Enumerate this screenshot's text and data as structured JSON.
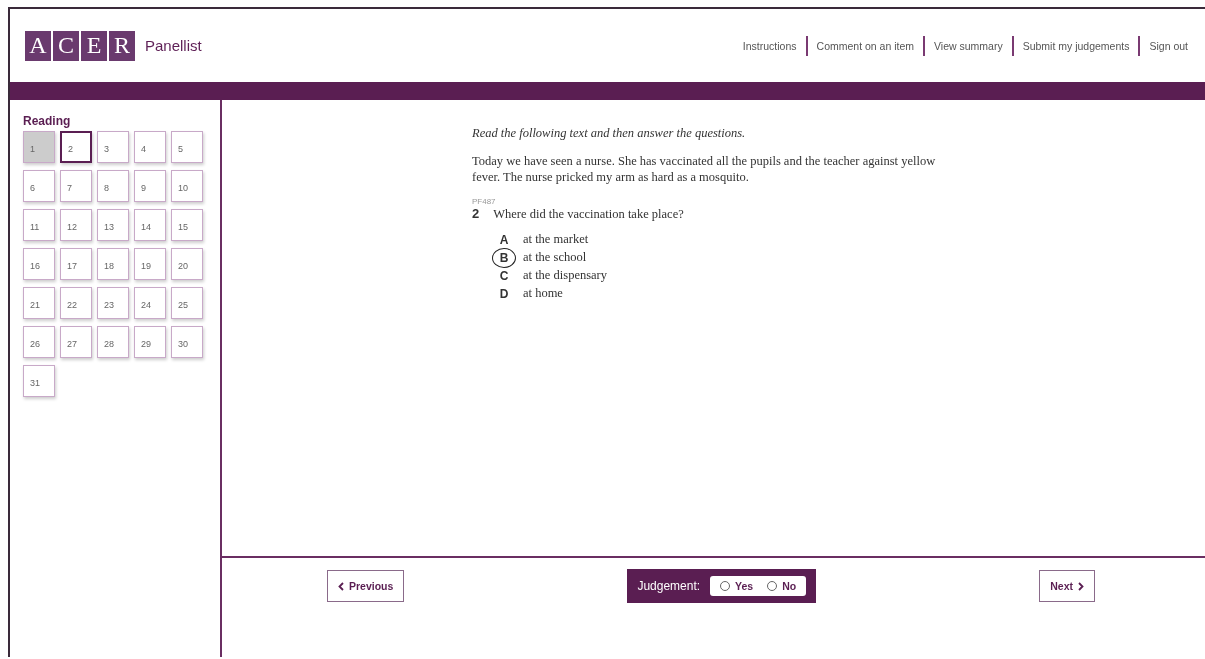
{
  "logo": {
    "letters": [
      "A",
      "C",
      "E",
      "R"
    ],
    "product": "Panellist"
  },
  "nav": [
    "Instructions",
    "Comment on an item",
    "View summary",
    "Submit my judgements",
    "Sign out"
  ],
  "sidebar": {
    "title": "Reading",
    "items": [
      {
        "label": "1",
        "selected": true,
        "current": false
      },
      {
        "label": "2",
        "selected": false,
        "current": true
      },
      {
        "label": "3",
        "selected": false,
        "current": false
      },
      {
        "label": "4",
        "selected": false,
        "current": false
      },
      {
        "label": "5",
        "selected": false,
        "current": false
      },
      {
        "label": "6",
        "selected": false,
        "current": false
      },
      {
        "label": "7",
        "selected": false,
        "current": false
      },
      {
        "label": "8",
        "selected": false,
        "current": false
      },
      {
        "label": "9",
        "selected": false,
        "current": false
      },
      {
        "label": "10",
        "selected": false,
        "current": false
      },
      {
        "label": "11",
        "selected": false,
        "current": false
      },
      {
        "label": "12",
        "selected": false,
        "current": false
      },
      {
        "label": "13",
        "selected": false,
        "current": false
      },
      {
        "label": "14",
        "selected": false,
        "current": false
      },
      {
        "label": "15",
        "selected": false,
        "current": false
      },
      {
        "label": "16",
        "selected": false,
        "current": false
      },
      {
        "label": "17",
        "selected": false,
        "current": false
      },
      {
        "label": "18",
        "selected": false,
        "current": false
      },
      {
        "label": "19",
        "selected": false,
        "current": false
      },
      {
        "label": "20",
        "selected": false,
        "current": false
      },
      {
        "label": "21",
        "selected": false,
        "current": false
      },
      {
        "label": "22",
        "selected": false,
        "current": false
      },
      {
        "label": "23",
        "selected": false,
        "current": false
      },
      {
        "label": "24",
        "selected": false,
        "current": false
      },
      {
        "label": "25",
        "selected": false,
        "current": false
      },
      {
        "label": "26",
        "selected": false,
        "current": false
      },
      {
        "label": "27",
        "selected": false,
        "current": false
      },
      {
        "label": "28",
        "selected": false,
        "current": false
      },
      {
        "label": "29",
        "selected": false,
        "current": false
      },
      {
        "label": "30",
        "selected": false,
        "current": false
      },
      {
        "label": "31",
        "selected": false,
        "current": false
      }
    ]
  },
  "item": {
    "instruction": "Read the following text and then answer the questions.",
    "passage": "Today we have seen a nurse. She has vaccinated all the pupils and the teacher against yellow fever. The nurse pricked my arm as hard as a mosquito.",
    "code": "PF487",
    "number": "2",
    "question": "Where did the vaccination take place?",
    "options": [
      {
        "letter": "A",
        "text": "at the market",
        "selected": false
      },
      {
        "letter": "B",
        "text": "at the school",
        "selected": true
      },
      {
        "letter": "C",
        "text": "at the dispensary",
        "selected": false
      },
      {
        "letter": "D",
        "text": "at home",
        "selected": false
      }
    ]
  },
  "footer": {
    "previous": "Previous",
    "next": "Next",
    "judgement": {
      "label": "Judgement:",
      "choices": [
        {
          "label": "Yes",
          "selected": false
        },
        {
          "label": "No",
          "selected": false
        }
      ]
    }
  }
}
